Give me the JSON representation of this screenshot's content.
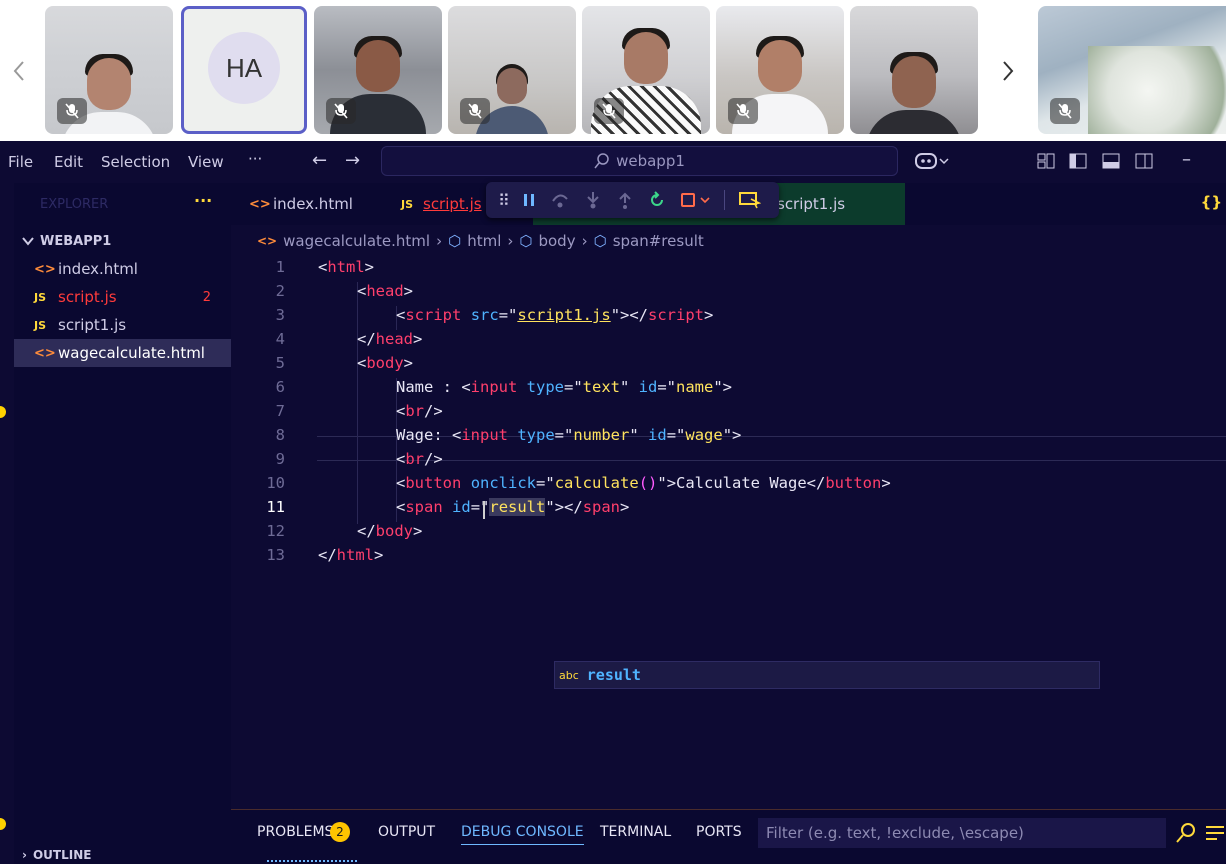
{
  "participants": {
    "prev_icon": "chevron-left-icon",
    "next_icon": "chevron-right-icon",
    "avatar_initials": "HA",
    "tiles_muted": true
  },
  "menu": [
    "File",
    "Edit",
    "Selection",
    "View"
  ],
  "menu_more": "···",
  "search": {
    "text": "webapp1"
  },
  "explorer": {
    "title": "EXPLORER",
    "more": "···",
    "folder": "WEBAPP1",
    "files": [
      {
        "icon": "<>",
        "name": "index.html",
        "color": "#cfcce6",
        "badge": ""
      },
      {
        "icon": "JS",
        "name": "script.js",
        "color": "#ff3b3b",
        "badge": "2"
      },
      {
        "icon": "JS",
        "name": "script1.js",
        "color": "#cfcce6",
        "badge": ""
      },
      {
        "icon": "<>",
        "name": "wagecalculate.html",
        "color": "#ffffff",
        "badge": ""
      }
    ],
    "outline": "OUTLINE"
  },
  "tabs": [
    {
      "icon": "<>",
      "name": "index.html"
    },
    {
      "icon": "JS",
      "name": "script.js"
    },
    {
      "icon": "JS",
      "name": "script1.js"
    }
  ],
  "breadcrumb": [
    "wagecalculate.html",
    "html",
    "body",
    "span#result"
  ],
  "code_lines": [
    "1",
    "2",
    "3",
    "4",
    "5",
    "6",
    "7",
    "8",
    "9",
    "10",
    "11",
    "12",
    "13"
  ],
  "code": {
    "l1": [
      "<",
      "html",
      ">"
    ],
    "l2": [
      "<",
      "head",
      ">"
    ],
    "l3": [
      "<",
      "script",
      " ",
      "src",
      "=\"",
      "script1.js",
      "\"></",
      "script",
      ">"
    ],
    "l4": [
      "</",
      "head",
      ">"
    ],
    "l5": [
      "<",
      "body",
      ">"
    ],
    "l6": [
      "Name : <",
      "input",
      " ",
      "type",
      "=\"",
      "text",
      "\" ",
      "id",
      "=\"",
      "name",
      "\">"
    ],
    "l7": [
      "<",
      "br",
      "/>"
    ],
    "l8": [
      "Wage: <",
      "input",
      " ",
      "type",
      "=\"",
      "number",
      "\" ",
      "id",
      "=\"",
      "wage",
      "\">"
    ],
    "l9": [
      "<",
      "br",
      "/>"
    ],
    "l10": [
      "<",
      "button",
      " ",
      "onclick",
      "=\"",
      "calculate",
      "()",
      "\">Calculate Wage</",
      "button",
      ">"
    ],
    "l11": [
      "<",
      "span",
      " ",
      "id",
      "=\"",
      "result",
      "\"></",
      "span",
      ">"
    ],
    "l12": [
      "</",
      "body",
      ">"
    ],
    "l13": [
      "</",
      "html",
      ">"
    ]
  },
  "suggestion": {
    "kind": "abc",
    "text": "result"
  },
  "panel": {
    "tabs": [
      "PROBLEMS",
      "OUTPUT",
      "DEBUG CONSOLE",
      "TERMINAL",
      "PORTS"
    ],
    "problems_count": "2",
    "active": "DEBUG CONSOLE",
    "filter_placeholder": "Filter (e.g. text, !exclude, \\escape)"
  },
  "braces": "{}",
  "colors": {
    "bg": "#0d0a33",
    "accent": "#ff3f6c",
    "string": "#ffe35e",
    "attr": "#4fb3ff"
  }
}
